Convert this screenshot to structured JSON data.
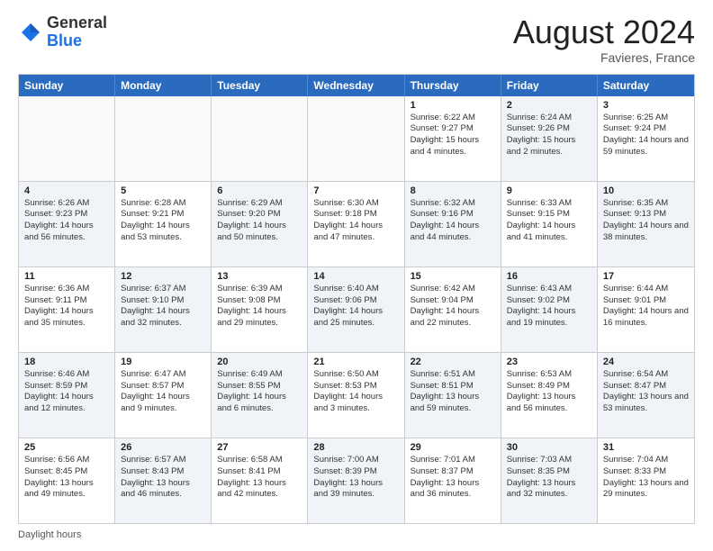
{
  "header": {
    "logo_general": "General",
    "logo_blue": "Blue",
    "month_year": "August 2024",
    "location": "Favieres, France"
  },
  "footer": {
    "daylight_label": "Daylight hours"
  },
  "weekdays": [
    "Sunday",
    "Monday",
    "Tuesday",
    "Wednesday",
    "Thursday",
    "Friday",
    "Saturday"
  ],
  "rows": [
    [
      {
        "day": "",
        "detail": "",
        "shaded": false,
        "empty": true
      },
      {
        "day": "",
        "detail": "",
        "shaded": false,
        "empty": true
      },
      {
        "day": "",
        "detail": "",
        "shaded": false,
        "empty": true
      },
      {
        "day": "",
        "detail": "",
        "shaded": false,
        "empty": true
      },
      {
        "day": "1",
        "detail": "Sunrise: 6:22 AM\nSunset: 9:27 PM\nDaylight: 15 hours\nand 4 minutes.",
        "shaded": false
      },
      {
        "day": "2",
        "detail": "Sunrise: 6:24 AM\nSunset: 9:26 PM\nDaylight: 15 hours\nand 2 minutes.",
        "shaded": true
      },
      {
        "day": "3",
        "detail": "Sunrise: 6:25 AM\nSunset: 9:24 PM\nDaylight: 14 hours\nand 59 minutes.",
        "shaded": false
      }
    ],
    [
      {
        "day": "4",
        "detail": "Sunrise: 6:26 AM\nSunset: 9:23 PM\nDaylight: 14 hours\nand 56 minutes.",
        "shaded": true
      },
      {
        "day": "5",
        "detail": "Sunrise: 6:28 AM\nSunset: 9:21 PM\nDaylight: 14 hours\nand 53 minutes.",
        "shaded": false
      },
      {
        "day": "6",
        "detail": "Sunrise: 6:29 AM\nSunset: 9:20 PM\nDaylight: 14 hours\nand 50 minutes.",
        "shaded": true
      },
      {
        "day": "7",
        "detail": "Sunrise: 6:30 AM\nSunset: 9:18 PM\nDaylight: 14 hours\nand 47 minutes.",
        "shaded": false
      },
      {
        "day": "8",
        "detail": "Sunrise: 6:32 AM\nSunset: 9:16 PM\nDaylight: 14 hours\nand 44 minutes.",
        "shaded": true
      },
      {
        "day": "9",
        "detail": "Sunrise: 6:33 AM\nSunset: 9:15 PM\nDaylight: 14 hours\nand 41 minutes.",
        "shaded": false
      },
      {
        "day": "10",
        "detail": "Sunrise: 6:35 AM\nSunset: 9:13 PM\nDaylight: 14 hours\nand 38 minutes.",
        "shaded": true
      }
    ],
    [
      {
        "day": "11",
        "detail": "Sunrise: 6:36 AM\nSunset: 9:11 PM\nDaylight: 14 hours\nand 35 minutes.",
        "shaded": false
      },
      {
        "day": "12",
        "detail": "Sunrise: 6:37 AM\nSunset: 9:10 PM\nDaylight: 14 hours\nand 32 minutes.",
        "shaded": true
      },
      {
        "day": "13",
        "detail": "Sunrise: 6:39 AM\nSunset: 9:08 PM\nDaylight: 14 hours\nand 29 minutes.",
        "shaded": false
      },
      {
        "day": "14",
        "detail": "Sunrise: 6:40 AM\nSunset: 9:06 PM\nDaylight: 14 hours\nand 25 minutes.",
        "shaded": true
      },
      {
        "day": "15",
        "detail": "Sunrise: 6:42 AM\nSunset: 9:04 PM\nDaylight: 14 hours\nand 22 minutes.",
        "shaded": false
      },
      {
        "day": "16",
        "detail": "Sunrise: 6:43 AM\nSunset: 9:02 PM\nDaylight: 14 hours\nand 19 minutes.",
        "shaded": true
      },
      {
        "day": "17",
        "detail": "Sunrise: 6:44 AM\nSunset: 9:01 PM\nDaylight: 14 hours\nand 16 minutes.",
        "shaded": false
      }
    ],
    [
      {
        "day": "18",
        "detail": "Sunrise: 6:46 AM\nSunset: 8:59 PM\nDaylight: 14 hours\nand 12 minutes.",
        "shaded": true
      },
      {
        "day": "19",
        "detail": "Sunrise: 6:47 AM\nSunset: 8:57 PM\nDaylight: 14 hours\nand 9 minutes.",
        "shaded": false
      },
      {
        "day": "20",
        "detail": "Sunrise: 6:49 AM\nSunset: 8:55 PM\nDaylight: 14 hours\nand 6 minutes.",
        "shaded": true
      },
      {
        "day": "21",
        "detail": "Sunrise: 6:50 AM\nSunset: 8:53 PM\nDaylight: 14 hours\nand 3 minutes.",
        "shaded": false
      },
      {
        "day": "22",
        "detail": "Sunrise: 6:51 AM\nSunset: 8:51 PM\nDaylight: 13 hours\nand 59 minutes.",
        "shaded": true
      },
      {
        "day": "23",
        "detail": "Sunrise: 6:53 AM\nSunset: 8:49 PM\nDaylight: 13 hours\nand 56 minutes.",
        "shaded": false
      },
      {
        "day": "24",
        "detail": "Sunrise: 6:54 AM\nSunset: 8:47 PM\nDaylight: 13 hours\nand 53 minutes.",
        "shaded": true
      }
    ],
    [
      {
        "day": "25",
        "detail": "Sunrise: 6:56 AM\nSunset: 8:45 PM\nDaylight: 13 hours\nand 49 minutes.",
        "shaded": false
      },
      {
        "day": "26",
        "detail": "Sunrise: 6:57 AM\nSunset: 8:43 PM\nDaylight: 13 hours\nand 46 minutes.",
        "shaded": true
      },
      {
        "day": "27",
        "detail": "Sunrise: 6:58 AM\nSunset: 8:41 PM\nDaylight: 13 hours\nand 42 minutes.",
        "shaded": false
      },
      {
        "day": "28",
        "detail": "Sunrise: 7:00 AM\nSunset: 8:39 PM\nDaylight: 13 hours\nand 39 minutes.",
        "shaded": true
      },
      {
        "day": "29",
        "detail": "Sunrise: 7:01 AM\nSunset: 8:37 PM\nDaylight: 13 hours\nand 36 minutes.",
        "shaded": false
      },
      {
        "day": "30",
        "detail": "Sunrise: 7:03 AM\nSunset: 8:35 PM\nDaylight: 13 hours\nand 32 minutes.",
        "shaded": true
      },
      {
        "day": "31",
        "detail": "Sunrise: 7:04 AM\nSunset: 8:33 PM\nDaylight: 13 hours\nand 29 minutes.",
        "shaded": false
      }
    ]
  ]
}
